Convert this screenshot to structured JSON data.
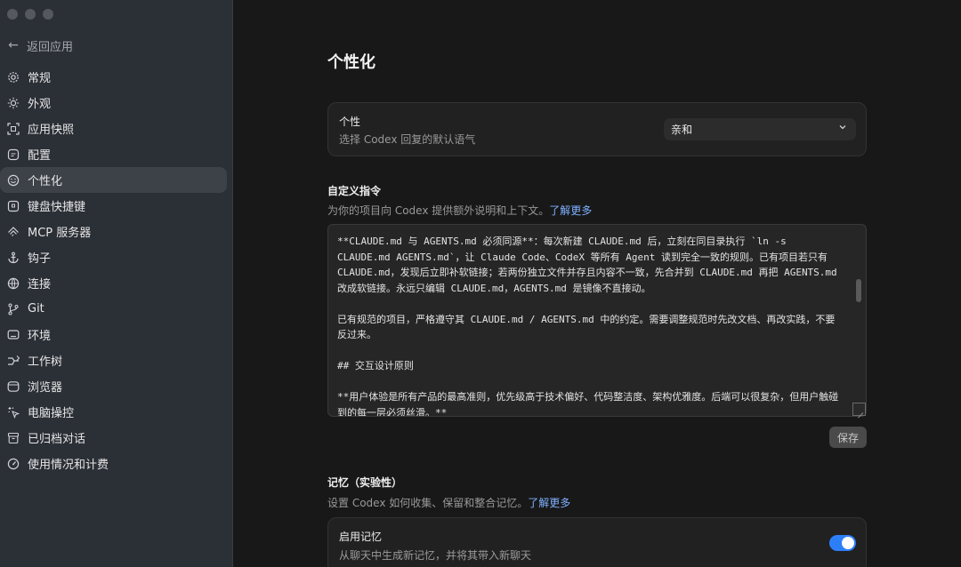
{
  "sidebar": {
    "back_label": "返回应用",
    "items": [
      {
        "label": "常规",
        "icon": "gear-icon"
      },
      {
        "label": "外观",
        "icon": "sun-icon"
      },
      {
        "label": "应用快照",
        "icon": "snapshot-icon"
      },
      {
        "label": "配置",
        "icon": "config-icon"
      },
      {
        "label": "个性化",
        "icon": "smile-icon",
        "active": true
      },
      {
        "label": "键盘快捷键",
        "icon": "keyboard-icon"
      },
      {
        "label": "MCP 服务器",
        "icon": "mcp-icon"
      },
      {
        "label": "钩子",
        "icon": "anchor-icon"
      },
      {
        "label": "连接",
        "icon": "globe-icon"
      },
      {
        "label": "Git",
        "icon": "git-branch-icon"
      },
      {
        "label": "环境",
        "icon": "monitor-icon"
      },
      {
        "label": "工作树",
        "icon": "worktree-icon"
      },
      {
        "label": "浏览器",
        "icon": "browser-icon"
      },
      {
        "label": "电脑操控",
        "icon": "sparkle-cursor-icon"
      },
      {
        "label": "已归档对话",
        "icon": "archive-icon"
      },
      {
        "label": "使用情况和计费",
        "icon": "gauge-icon"
      }
    ]
  },
  "main": {
    "title": "个性化",
    "personality": {
      "title": "个性",
      "subtitle": "选择 Codex 回复的默认语气",
      "selected": "亲和"
    },
    "custom": {
      "title": "自定义指令",
      "subtitle": "为你的项目向 Codex 提供额外说明和上下文。",
      "link": "了解更多",
      "content": "**CLAUDE.md 与 AGENTS.md 必须同源**：每次新建 CLAUDE.md 后，立刻在同目录执行 `ln -s CLAUDE.md AGENTS.md`，让 Claude Code、CodeX 等所有 Agent 读到完全一致的规则。已有项目若只有 CLAUDE.md，发现后立即补软链接；若两份独立文件并存且内容不一致，先合并到 CLAUDE.md 再把 AGENTS.md 改成软链接。永远只编辑 CLAUDE.md，AGENTS.md 是镜像不直接动。\n\n已有规范的项目，严格遵守其 CLAUDE.md / AGENTS.md 中的约定。需要调整规范时先改文档、再改实践，不要反过来。\n\n## 交互设计原则\n\n**用户体验是所有产品的最高准则，优先级高于技术偏好、代码整洁度、架构优雅度。后端可以很复杂，但用户触碰到的每一层必须丝滑。**",
      "save_label": "保存"
    },
    "memory": {
      "title": "记忆（实验性）",
      "subtitle": "设置 Codex 如何收集、保留和整合记忆。",
      "link": "了解更多",
      "enable_title": "启用记忆",
      "enable_subtitle": "从聊天中生成新记忆，并将其带入新聊天",
      "enabled": true
    }
  },
  "colors": {
    "accent": "#2d7ff9",
    "link": "#7fb0ff"
  }
}
